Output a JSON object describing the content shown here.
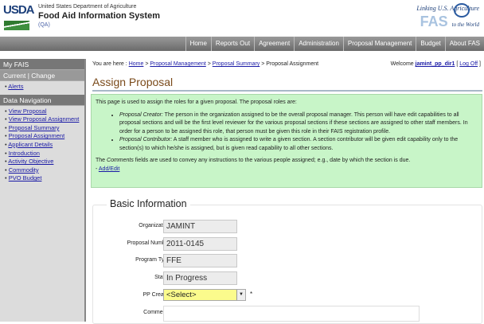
{
  "header": {
    "logo": "USDA",
    "department": "United States Department of Agriculture",
    "system": "Food Aid Information System",
    "env": "(QA)",
    "tagline": "Linking U.S. Agriculture",
    "fas_logo": "FAS",
    "fas_sub": "to the World"
  },
  "nav": [
    "Home",
    "Reports Out",
    "Agreement",
    "Administration",
    "Proposal Management",
    "Budget",
    "About FAS"
  ],
  "sidebar": {
    "my_fais": "My FAIS",
    "current": "Current | Change",
    "alerts": "Alerts",
    "data_nav": "Data Navigation",
    "items": [
      "View Proposal",
      "View Proposal Assignment",
      "Proposal Summary",
      "Proposal Assignment",
      "Applicant Details",
      "Introduction",
      "Activity Objective",
      "Commodity",
      "PVO Budget"
    ]
  },
  "breadcrumb": {
    "prefix": "You are here :",
    "items": [
      "Home",
      "Proposal Management",
      "Proposal Summary"
    ],
    "sep": " > ",
    "current": "Proposal Assignment"
  },
  "welcome": {
    "label": "Welcome",
    "user": "jamint_pp_dir1",
    "logoff": "Log Off"
  },
  "title": "Assign Proposal",
  "info": {
    "intro": "This page is used to assign the roles for a given proposal. The proposal roles are:",
    "creator_term": "Proposal Creator:",
    "creator_text": " The person in the organization assigned to be the overall proposal manager. This person will have edit capabilities to all proposal sections and will be the first level reviewer for the various proposal sections if these sections are assigned to other staff members. In order for a person to be assigned this role, that person must be given this role in their FAIS registration profile.",
    "contrib_term": "Proposal Contributor:",
    "contrib_text": " A staff member who is assigned to write a given section. A section contributor will be given edit capability only to the section(s) to which he/she is assigned, but is given read capability to all other sections.",
    "comments_pre": "The ",
    "comments_term": "Comments",
    "comments_text": " fields are used to convey any instructions to the various people assigned; e.g., date by which the section is due.",
    "add_edit": "Add/Edit"
  },
  "form": {
    "legend": "Basic Information",
    "organization_label": "Organization",
    "organization": "JAMINT",
    "proposal_number_label": "Proposal Number",
    "proposal_number": "2011-0145",
    "program_type_label": "Program Type",
    "program_type": "FFE",
    "status_label": "Status",
    "status": "In Progress",
    "pp_creator_label": "PP Creator",
    "pp_creator": "<Select>",
    "required": "*",
    "comments_label": "Comments"
  }
}
